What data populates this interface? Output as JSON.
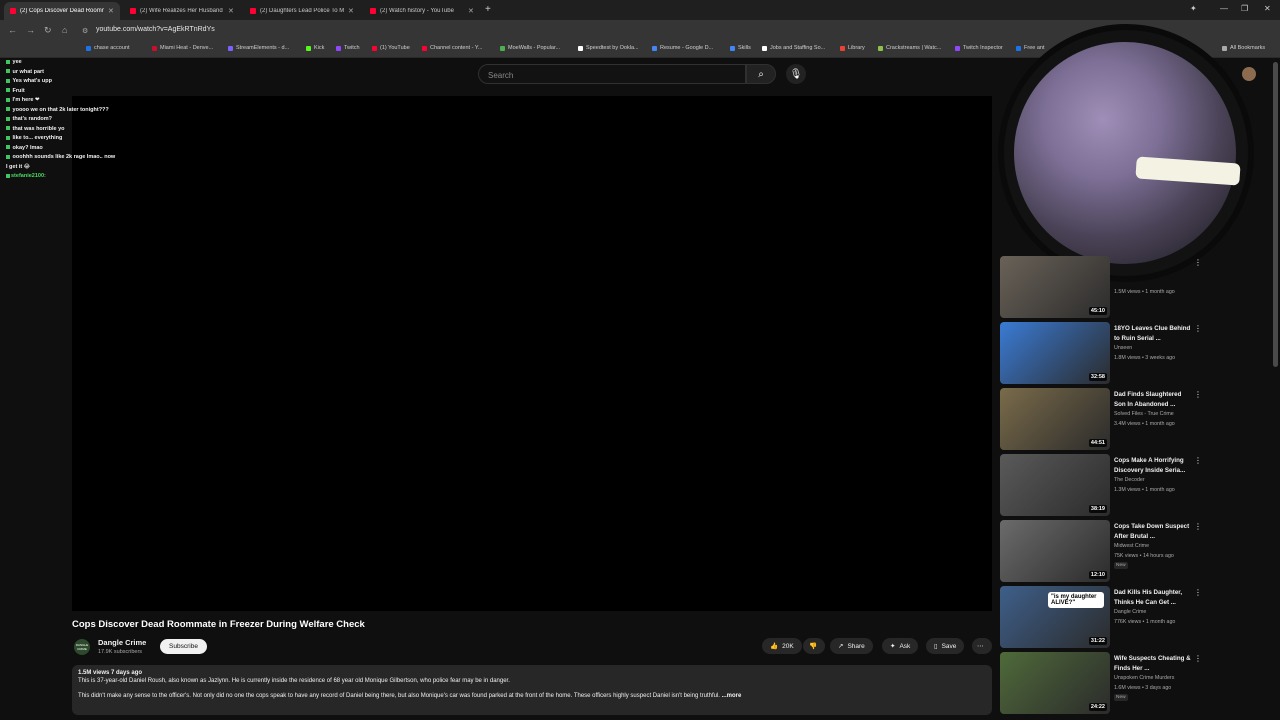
{
  "browser": {
    "tabs": [
      {
        "label": "(2) Cops Discover Dead Roommate",
        "active": true
      },
      {
        "label": "(2) Wife Realizes Her Husband",
        "active": false
      },
      {
        "label": "(2) Daughters Lead Police To M",
        "active": false
      },
      {
        "label": "(2) Watch history - YouTube",
        "active": false
      }
    ],
    "new_tab": "+",
    "url": "youtube.com/watch?v=AgEkRTnRdYs",
    "bookmarks": [
      {
        "label": "chase account",
        "color": "#1a73e8"
      },
      {
        "label": "Miami Heat - Denve...",
        "color": "#c8102e"
      },
      {
        "label": "StreamElements - d...",
        "color": "#7b61ff"
      },
      {
        "label": "Kick",
        "color": "#53fc18"
      },
      {
        "label": "Twitch",
        "color": "#9146ff"
      },
      {
        "label": "(1) YouTube",
        "color": "#ff0033"
      },
      {
        "label": "Channel content - Y...",
        "color": "#ff0033"
      },
      {
        "label": "MoeWalls - Popular...",
        "color": "#4caf50"
      },
      {
        "label": "Speedtest by Ookla...",
        "color": "#ffffff"
      },
      {
        "label": "Resume - Google D...",
        "color": "#4285f4"
      },
      {
        "label": "Skills",
        "color": "#4285f4"
      },
      {
        "label": "Jobs and Staffing So...",
        "color": "#ffffff"
      },
      {
        "label": "Library",
        "color": "#ea4335"
      },
      {
        "label": "Crackstreams | Watc...",
        "color": "#8bc34a"
      },
      {
        "label": "Twitch Inspector",
        "color": "#9146ff"
      },
      {
        "label": "Free ant",
        "color": "#1a73e8"
      }
    ],
    "all_bookmarks": "All Bookmarks"
  },
  "search": {
    "placeholder": "Search"
  },
  "chat": [
    {
      "user": "",
      "text": "yee"
    },
    {
      "user": "",
      "text": "ur what part"
    },
    {
      "user": "",
      "text": "Yes what's upp"
    },
    {
      "user": "",
      "text": "Fruit"
    },
    {
      "user": "",
      "text": "I'm here ❤"
    },
    {
      "user": "",
      "text": "yoooo we on that 2k later tonight???"
    },
    {
      "user": "",
      "text": "that's random?"
    },
    {
      "user": "",
      "text": "that was horrible yo"
    },
    {
      "user": "",
      "text": "like to... everything"
    },
    {
      "user": "",
      "text": "okay? lmao"
    },
    {
      "user": "",
      "text": "ooohhh sounds like 2k rage lmao.. now I get it 😂"
    },
    {
      "user": "stefanie2100:",
      "text": ""
    }
  ],
  "video": {
    "title": "Cops Discover Dead Roommate in Freezer During Welfare Check",
    "channel": "Dangle Crime",
    "channel_avatar_text": "DANGLE CRIME",
    "subscribers": "17.9K subscribers",
    "subscribe_label": "Subscribe",
    "likes": "20K",
    "share_label": "Share",
    "ask_label": "Ask",
    "save_label": "Save",
    "views_date": "1.5M views  7 days ago",
    "description_line1": "This is 37-year-old Daniel Roush, also known as Jazlynn. He is currently inside the residence of 68 year old Monique Gilbertson, who police fear may be in danger.",
    "description_line2": "This didn't make any sense to the officer's. Not only did no one the cops speak to have any record of Daniel being there, but also Monique's car was found parked at the front of the home. These officers highly suspect Daniel isn't being truthful.",
    "more_label": "...more"
  },
  "recommendations": [
    {
      "title": "",
      "channel": "",
      "meta": "1.5M views • 1 month ago",
      "duration": "45:10",
      "new": false,
      "thumb": "#6a6258"
    },
    {
      "title": "18YO Leaves Clue Behind to Ruin Serial ...",
      "channel": "Unseen",
      "meta": "1.8M views • 3 weeks ago",
      "duration": "32:58",
      "new": false,
      "thumb": "#3a7bd5"
    },
    {
      "title": "Dad Finds Slaughtered Son In Abandoned ...",
      "channel": "Solved Files - True Crime",
      "meta": "3.4M views • 1 month ago",
      "duration": "44:51",
      "new": false,
      "thumb": "#7a6b4a"
    },
    {
      "title": "Cops Make A Horrifying Discovery Inside Seria...",
      "channel": "The Decoder",
      "meta": "1.3M views • 1 month ago",
      "duration": "38:19",
      "new": false,
      "thumb": "#5a5a5a"
    },
    {
      "title": "Cops Take Down Suspect After Brutal ...",
      "channel": "Midwest Crime",
      "meta": "75K views • 14 hours ago",
      "duration": "12:10",
      "new": true,
      "thumb": "#6b6b6b"
    },
    {
      "title": "Dad Kills His Daughter, Thinks He Can Get ...",
      "channel": "Dangle Crime",
      "meta": "776K views • 1 month ago",
      "duration": "31:22",
      "new": false,
      "thumb": "#3e5f8a",
      "overlay": "\"is my daughter ALIVE?\""
    },
    {
      "title": "Wife Suspects Cheating & Finds Her ...",
      "channel": "Unspoken Crime Murders",
      "meta": "1.6M views • 3 days ago",
      "duration": "24:22",
      "new": true,
      "thumb": "#4f6a3a"
    }
  ],
  "new_badge": "New"
}
